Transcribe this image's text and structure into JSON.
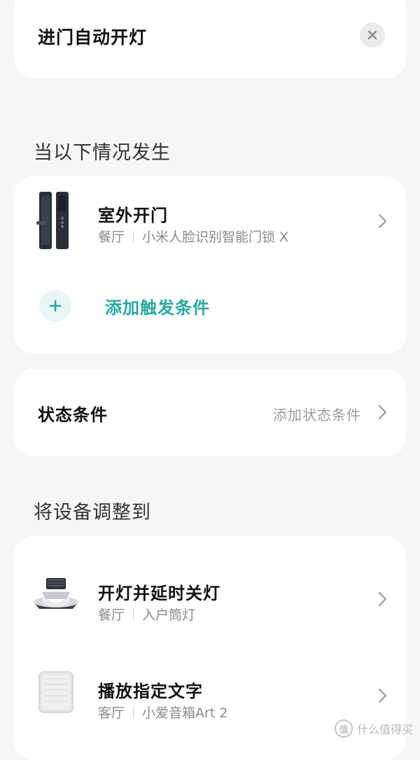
{
  "header": {
    "title": "进门自动开灯"
  },
  "trigger_section": {
    "heading": "当以下情况发生",
    "item": {
      "title": "室外开门",
      "room": "餐厅",
      "device": "小米人脸识别智能门锁 X",
      "icon": "door-lock-icon"
    },
    "add_label": "添加触发条件"
  },
  "state_section": {
    "label": "状态条件",
    "value": "添加状态条件"
  },
  "action_section": {
    "heading": "将设备调整到",
    "items": [
      {
        "title": "开灯并延时关灯",
        "room": "餐厅",
        "device": "入户筒灯",
        "icon": "downlight-icon"
      },
      {
        "title": "播放指定文字",
        "room": "客厅",
        "device": "小爱音箱Art 2",
        "icon": "speaker-icon"
      }
    ]
  },
  "watermark": {
    "badge": "值",
    "text": "什么值得买"
  },
  "colors": {
    "accent": "#27a99f",
    "background": "#f6f6f6",
    "card": "#ffffff"
  }
}
